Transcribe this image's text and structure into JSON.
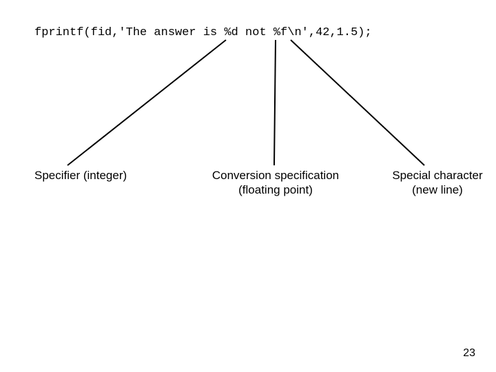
{
  "code": {
    "text": "fprintf(fid,'The answer is %d not %f\\n',42,1.5);"
  },
  "labels": {
    "specifier_integer_line1": "Specifier (integer)",
    "conversion_spec_line1": "Conversion  specification",
    "conversion_spec_line2": "(floating point)",
    "special_char_line1": "Special character",
    "special_char_line2": "(new line)"
  },
  "page_number": "23"
}
